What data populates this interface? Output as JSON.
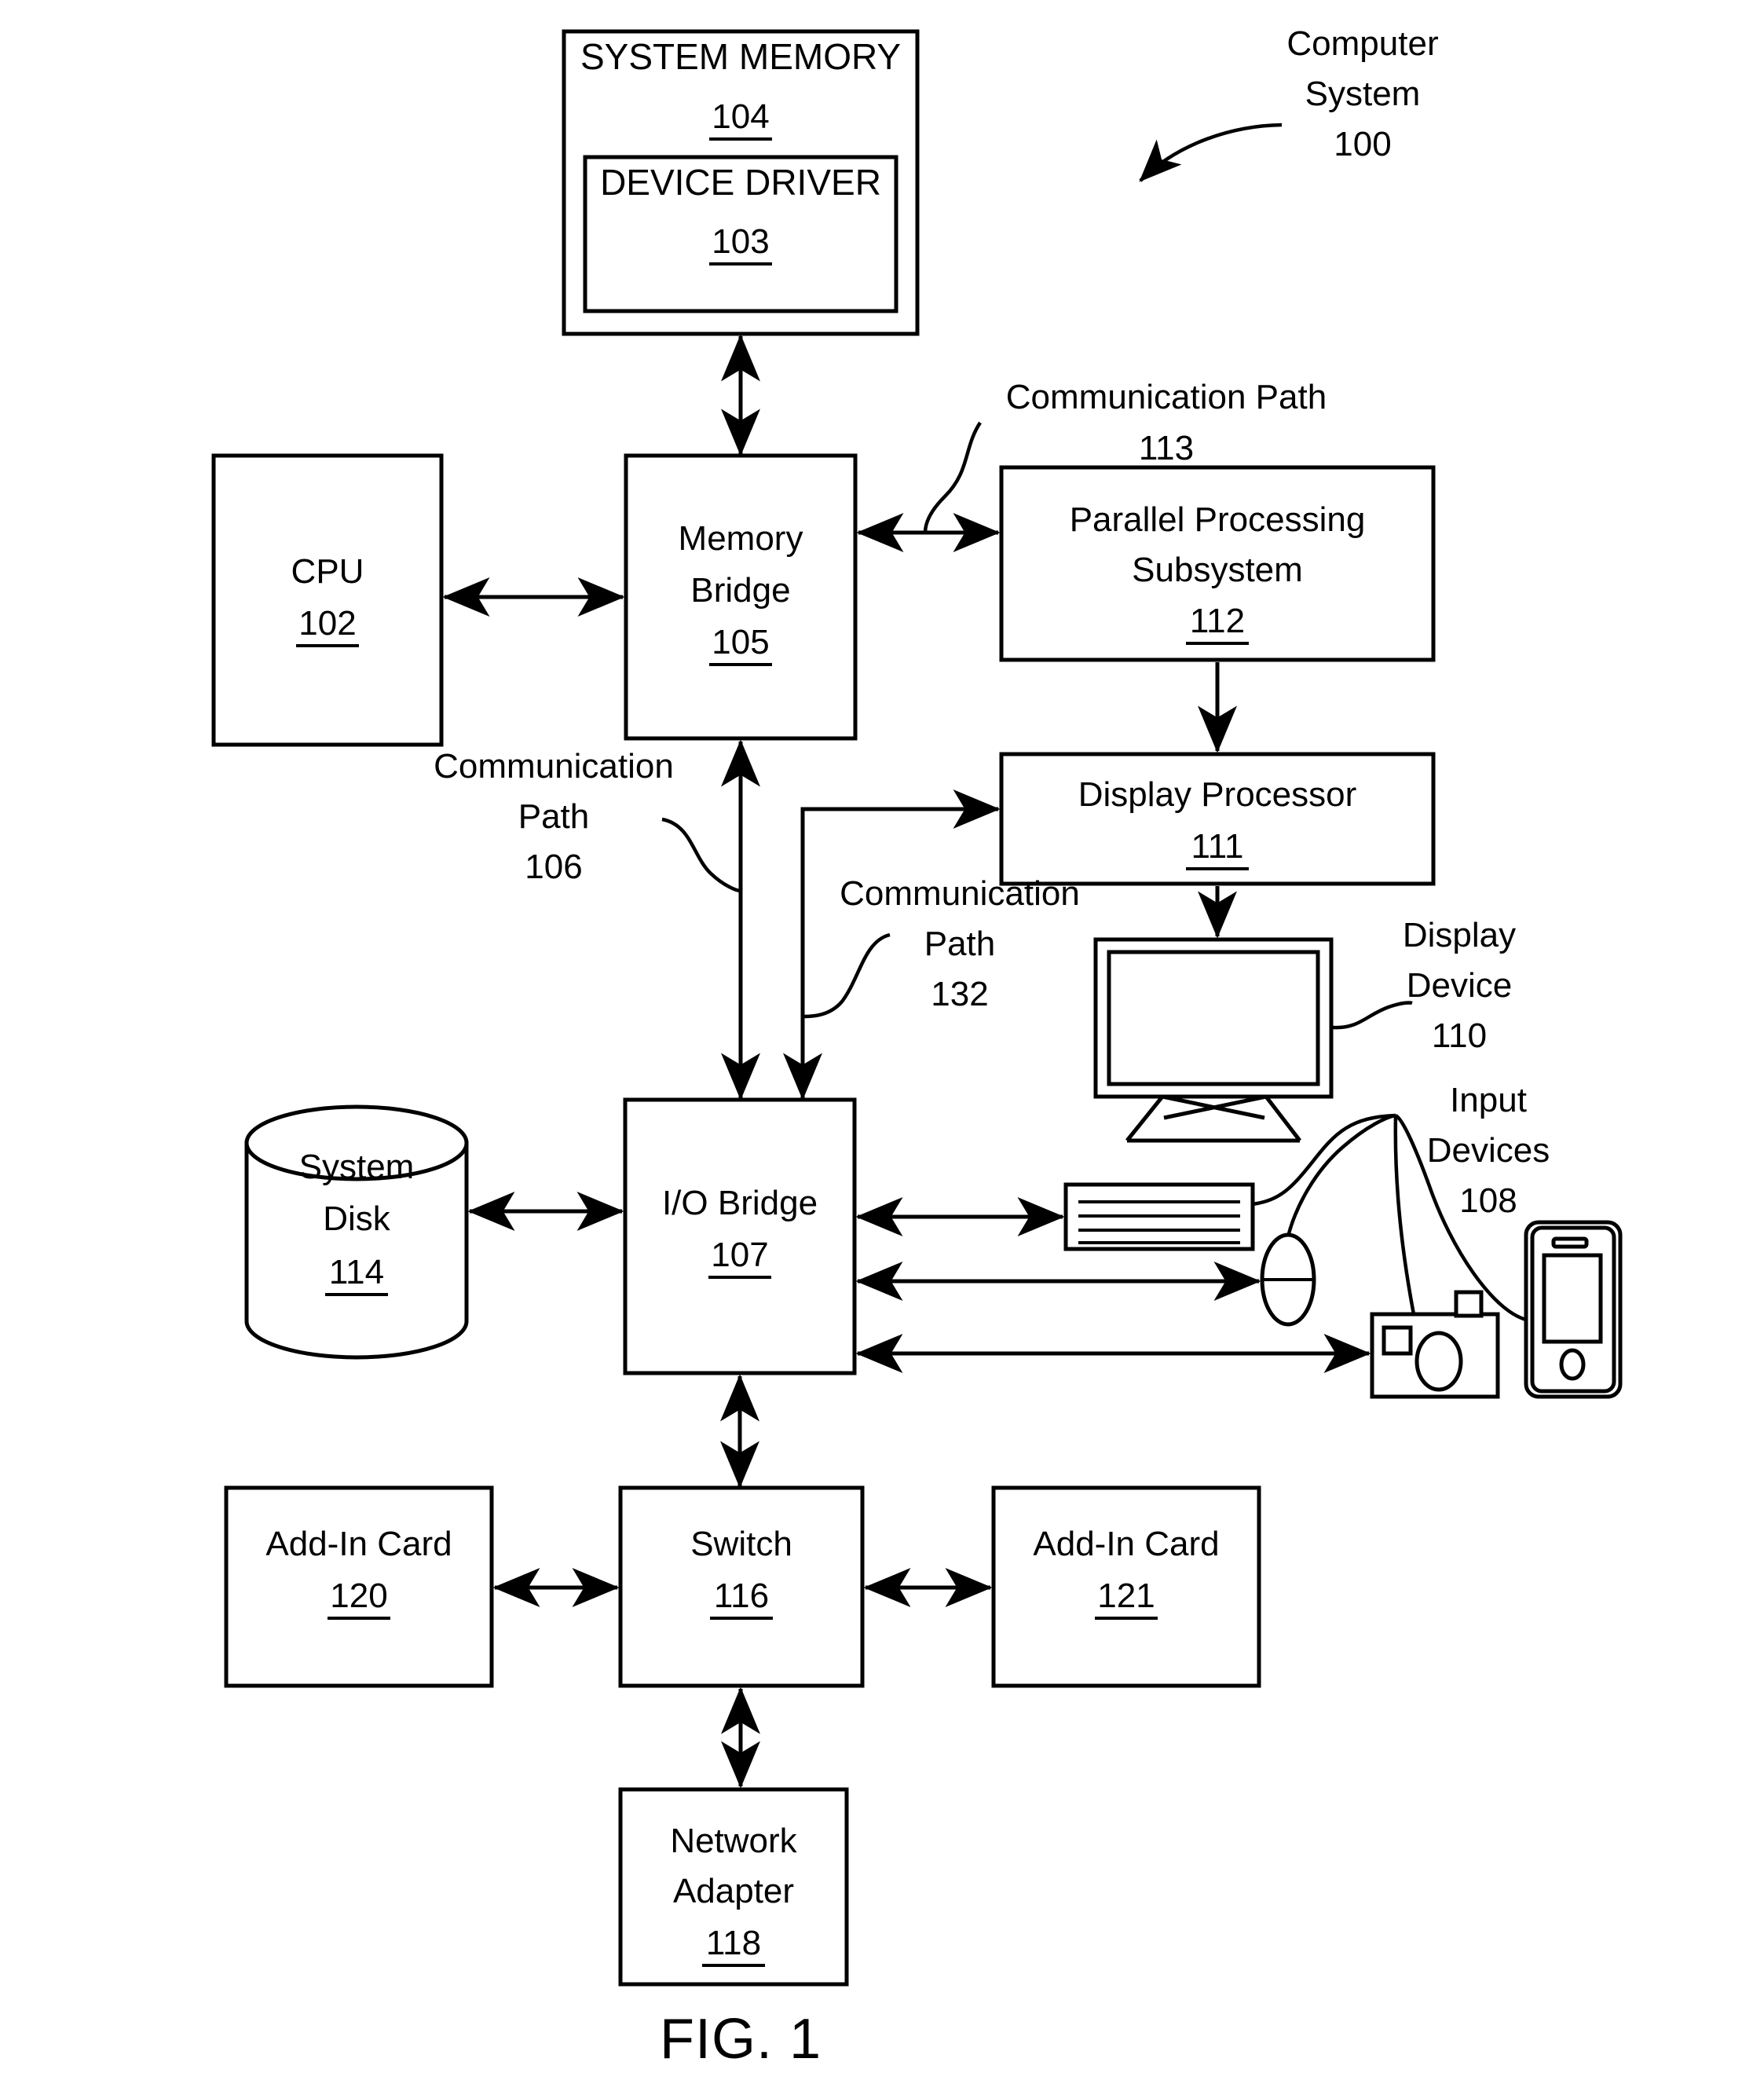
{
  "figure": {
    "caption": "FIG. 1",
    "title_label": {
      "line1": "Computer",
      "line2": "System",
      "number": "100"
    }
  },
  "blocks": {
    "system_memory": {
      "label": "SYSTEM MEMORY",
      "number": "104"
    },
    "device_driver": {
      "label": "DEVICE DRIVER",
      "number": "103"
    },
    "cpu": {
      "label": "CPU",
      "number": "102"
    },
    "memory_bridge": {
      "line1": "Memory",
      "line2": "Bridge",
      "number": "105"
    },
    "parallel_processing_subsystem": {
      "line1": "Parallel Processing",
      "line2": "Subsystem",
      "number": "112"
    },
    "display_processor": {
      "label": "Display Processor",
      "number": "111"
    },
    "display_device": {
      "line1": "Display",
      "line2": "Device",
      "number": "110"
    },
    "input_devices": {
      "line1": "Input",
      "line2": "Devices",
      "number": "108"
    },
    "system_disk": {
      "line1": "System",
      "line2": "Disk",
      "number": "114"
    },
    "io_bridge": {
      "label": "I/O Bridge",
      "number": "107"
    },
    "add_in_card_120": {
      "label": "Add-In Card",
      "number": "120"
    },
    "switch": {
      "label": "Switch",
      "number": "116"
    },
    "add_in_card_121": {
      "label": "Add-In Card",
      "number": "121"
    },
    "network_adapter": {
      "line1": "Network",
      "line2": "Adapter",
      "number": "118"
    }
  },
  "paths": {
    "comm_113": {
      "line1": "Communication Path",
      "number": "113"
    },
    "comm_106": {
      "line1": "Communication",
      "line2": "Path",
      "number": "106"
    },
    "comm_132": {
      "line1": "Communication",
      "line2": "Path",
      "number": "132"
    }
  },
  "icons": {
    "keyboard": "keyboard-icon",
    "mouse": "mouse-icon",
    "camera": "camera-icon",
    "phone": "smartphone-icon",
    "monitor": "monitor-icon",
    "disk": "cylinder-disk-icon"
  },
  "colors": {
    "stroke": "#000000",
    "background": "#ffffff"
  }
}
